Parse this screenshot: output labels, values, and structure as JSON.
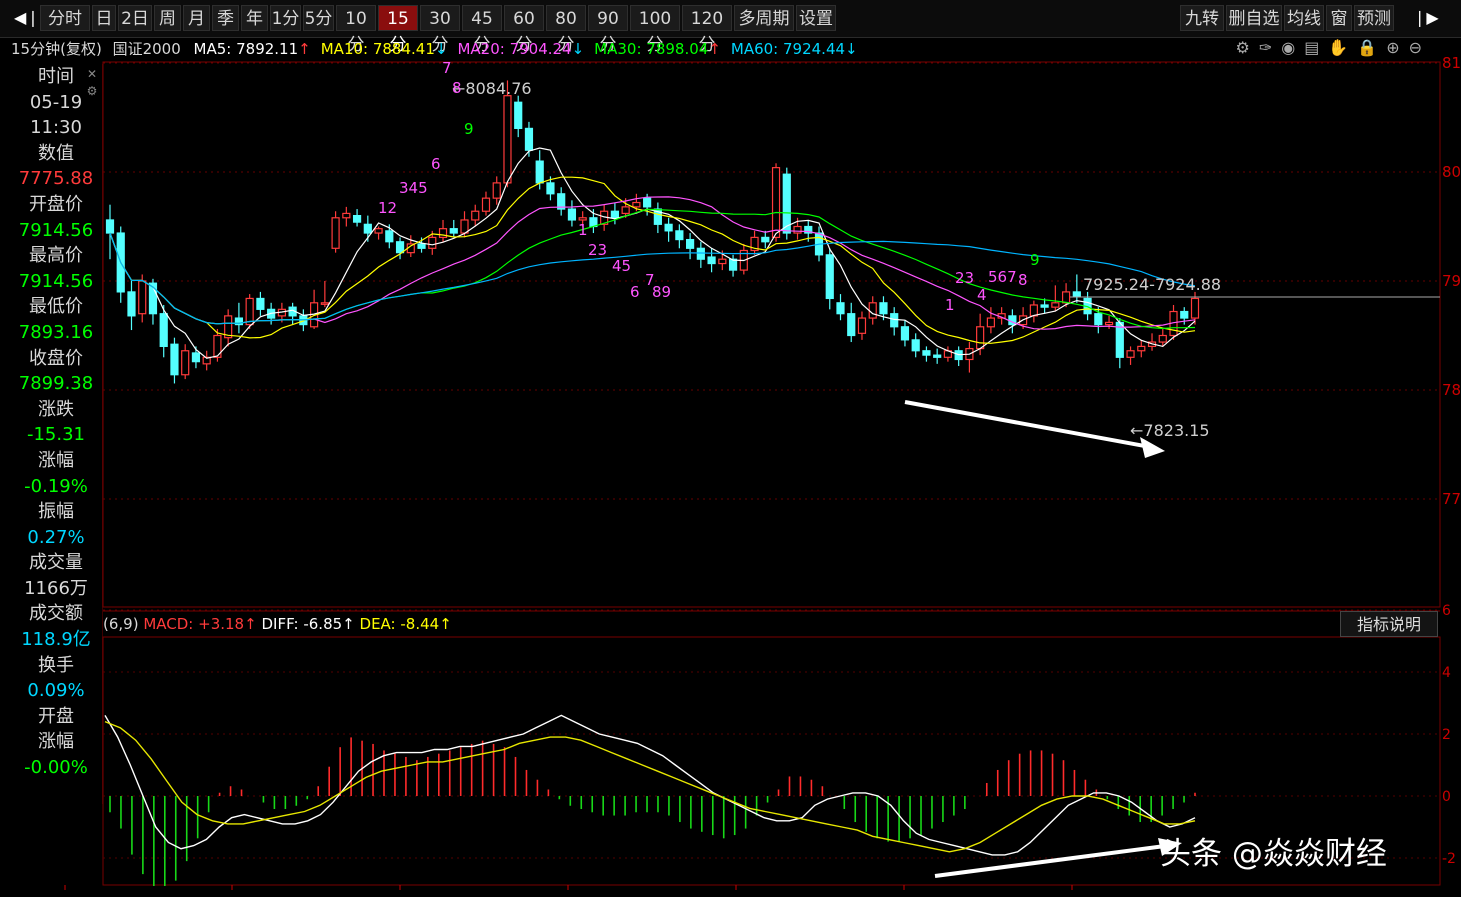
{
  "toolbar": {
    "periods": [
      "分时",
      "日",
      "2日",
      "周",
      "月",
      "季",
      "年",
      "1分",
      "5分",
      "10分",
      "15分",
      "30分",
      "45分",
      "60分",
      "80分",
      "90分",
      "100分",
      "120分",
      "多周期",
      "设置"
    ],
    "active_period": "15分",
    "right_tools": [
      "九转",
      "删自选",
      "均线",
      "窗",
      "预测"
    ]
  },
  "header": {
    "title": "15分钟(复权)",
    "index_name": "国证2000",
    "ma": [
      {
        "label": "MA5: 7892.11",
        "arrow": "↑",
        "color": "#ffffff"
      },
      {
        "label": "MA10: 7884.41",
        "arrow": "↓",
        "color": "#ffff00"
      },
      {
        "label": "MA20: 7904.24",
        "arrow": "↓",
        "color": "#ff55ff"
      },
      {
        "label": "MA30: 7898.04",
        "arrow": "↑",
        "color": "#00ff00"
      },
      {
        "label": "MA60: 7924.44",
        "arrow": "↓",
        "color": "#00d7ff"
      }
    ]
  },
  "info_panel": {
    "time_label": "时间",
    "date": "05-19",
    "time": "11:30",
    "value_label": "数值",
    "value": "7775.88",
    "open_label": "开盘价",
    "open": "7914.56",
    "high_label": "最高价",
    "high": "7914.56",
    "low_label": "最低价",
    "low": "7893.16",
    "close_label": "收盘价",
    "close": "7899.38",
    "change_label": "涨跌",
    "change": "-15.31",
    "pct_label": "涨幅",
    "pct": "-0.19%",
    "amp_label": "振幅",
    "amp": "0.27%",
    "vol_label": "成交量",
    "vol": "1166万",
    "amt_label": "成交额",
    "amt": "118.9亿",
    "turn_label": "换手",
    "turn": "0.09%",
    "open_pct_label1": "开盘",
    "open_pct_label2": "涨幅",
    "open_pct": "-0.00%"
  },
  "macd_header": {
    "params": "(6,9)",
    "macd": "MACD: +3.18",
    "diff": "DIFF: -6.85",
    "dea": "DEA: -8.44"
  },
  "indicator_button": "指标说明",
  "watermark": "头条 @焱焱财经",
  "chart_data": {
    "type": "candlestick",
    "price_axis_partial": [
      "81",
      "80",
      "79",
      "78",
      "77"
    ],
    "macd_axis_partial": [
      "6",
      "4",
      "2",
      "0",
      "-2"
    ],
    "annotations": {
      "high_marker": "8084.76",
      "low_marker": "7823.15",
      "price_line_label": "7925.24-7924.88"
    },
    "td_counts": [
      {
        "text": "12",
        "color": "#ff55ff"
      },
      {
        "text": "345",
        "color": "#ff55ff"
      },
      {
        "text": "6",
        "color": "#ff55ff"
      },
      {
        "text": "7",
        "color": "#ff55ff"
      },
      {
        "text": "8",
        "color": "#ff55ff"
      },
      {
        "text": "9",
        "color": "#00ff00"
      },
      {
        "text": "1",
        "color": "#ff55ff"
      },
      {
        "text": "23",
        "color": "#ff55ff"
      },
      {
        "text": "45",
        "color": "#ff55ff"
      },
      {
        "text": "6",
        "color": "#ff55ff"
      },
      {
        "text": "7",
        "color": "#ff55ff"
      },
      {
        "text": "89",
        "color": "#ff55ff"
      },
      {
        "text": "1",
        "color": "#ff55ff"
      },
      {
        "text": "23",
        "color": "#ff55ff"
      },
      {
        "text": "4",
        "color": "#ff55ff"
      },
      {
        "text": "567",
        "color": "#ff55ff"
      },
      {
        "text": "8",
        "color": "#ff55ff"
      },
      {
        "text": "9",
        "color": "#00ff00"
      }
    ],
    "candles": [
      [
        7956,
        7944,
        7970,
        7920
      ],
      [
        7944,
        7890,
        7950,
        7880
      ],
      [
        7890,
        7868,
        7900,
        7855
      ],
      [
        7870,
        7900,
        7906,
        7862
      ],
      [
        7898,
        7870,
        7902,
        7860
      ],
      [
        7870,
        7840,
        7878,
        7830
      ],
      [
        7842,
        7814,
        7848,
        7806
      ],
      [
        7814,
        7836,
        7842,
        7810
      ],
      [
        7834,
        7826,
        7840,
        7820
      ],
      [
        7824,
        7830,
        7836,
        7818
      ],
      [
        7830,
        7850,
        7856,
        7826
      ],
      [
        7848,
        7868,
        7874,
        7840
      ],
      [
        7866,
        7860,
        7880,
        7852
      ],
      [
        7860,
        7884,
        7888,
        7856
      ],
      [
        7884,
        7874,
        7890,
        7868
      ],
      [
        7874,
        7866,
        7880,
        7860
      ],
      [
        7868,
        7874,
        7880,
        7862
      ],
      [
        7876,
        7868,
        7880,
        7860
      ],
      [
        7868,
        7860,
        7874,
        7854
      ],
      [
        7858,
        7880,
        7892,
        7856
      ],
      [
        7880,
        7880,
        7900,
        7876
      ],
      [
        7930,
        7958,
        7964,
        7926
      ],
      [
        7958,
        7962,
        7968,
        7950
      ],
      [
        7960,
        7954,
        7966,
        7950
      ],
      [
        7952,
        7944,
        7960,
        7936
      ],
      [
        7944,
        7948,
        7950,
        7938
      ],
      [
        7946,
        7936,
        7952,
        7930
      ],
      [
        7936,
        7926,
        7940,
        7920
      ],
      [
        7926,
        7934,
        7942,
        7922
      ],
      [
        7934,
        7930,
        7940,
        7926
      ],
      [
        7930,
        7940,
        7946,
        7924
      ],
      [
        7940,
        7948,
        7956,
        7936
      ],
      [
        7948,
        7944,
        7956,
        7940
      ],
      [
        7944,
        7956,
        7964,
        7940
      ],
      [
        7956,
        7964,
        7970,
        7950
      ],
      [
        7964,
        7976,
        7982,
        7960
      ],
      [
        7976,
        7990,
        7996,
        7970
      ],
      [
        7990,
        8070,
        8084,
        7986
      ],
      [
        8064,
        8040,
        8070,
        8032
      ],
      [
        8040,
        8020,
        8046,
        8014
      ],
      [
        8010,
        7990,
        8020,
        7984
      ],
      [
        7990,
        7980,
        7996,
        7974
      ],
      [
        7980,
        7966,
        7986,
        7960
      ],
      [
        7966,
        7956,
        7974,
        7950
      ],
      [
        7956,
        7958,
        7964,
        7950
      ],
      [
        7958,
        7950,
        7966,
        7944
      ],
      [
        7952,
        7964,
        7970,
        7946
      ],
      [
        7964,
        7958,
        7972,
        7952
      ],
      [
        7962,
        7968,
        7976,
        7958
      ],
      [
        7968,
        7972,
        7980,
        7964
      ],
      [
        7976,
        7968,
        7980,
        7960
      ],
      [
        7966,
        7952,
        7972,
        7944
      ],
      [
        7952,
        7946,
        7958,
        7936
      ],
      [
        7946,
        7938,
        7952,
        7930
      ],
      [
        7938,
        7930,
        7944,
        7920
      ],
      [
        7930,
        7920,
        7936,
        7912
      ],
      [
        7922,
        7916,
        7930,
        7908
      ],
      [
        7916,
        7920,
        7928,
        7910
      ],
      [
        7920,
        7910,
        7924,
        7904
      ],
      [
        7910,
        7928,
        7934,
        7906
      ],
      [
        7928,
        7940,
        7946,
        7924
      ],
      [
        7940,
        7936,
        7946,
        7930
      ],
      [
        7940,
        8004,
        8008,
        7936
      ],
      [
        7998,
        7944,
        8004,
        7938
      ],
      [
        7944,
        7950,
        7958,
        7938
      ],
      [
        7950,
        7944,
        7956,
        7936
      ],
      [
        7944,
        7924,
        7950,
        7918
      ],
      [
        7924,
        7884,
        7930,
        7874
      ],
      [
        7880,
        7870,
        7888,
        7864
      ],
      [
        7870,
        7850,
        7880,
        7844
      ],
      [
        7852,
        7866,
        7872,
        7846
      ],
      [
        7866,
        7880,
        7886,
        7860
      ],
      [
        7880,
        7870,
        7886,
        7864
      ],
      [
        7870,
        7858,
        7876,
        7850
      ],
      [
        7858,
        7846,
        7864,
        7840
      ],
      [
        7846,
        7836,
        7852,
        7830
      ],
      [
        7836,
        7832,
        7840,
        7826
      ],
      [
        7832,
        7830,
        7838,
        7824
      ],
      [
        7830,
        7836,
        7840,
        7826
      ],
      [
        7836,
        7828,
        7840,
        7822
      ],
      [
        7828,
        7838,
        7844,
        7816
      ],
      [
        7838,
        7858,
        7870,
        7832
      ],
      [
        7858,
        7866,
        7876,
        7852
      ],
      [
        7866,
        7870,
        7876,
        7860
      ],
      [
        7868,
        7860,
        7874,
        7852
      ],
      [
        7860,
        7868,
        7876,
        7856
      ],
      [
        7868,
        7878,
        7882,
        7862
      ],
      [
        7878,
        7876,
        7884,
        7870
      ],
      [
        7876,
        7880,
        7896,
        7872
      ],
      [
        7880,
        7890,
        7898,
        7876
      ],
      [
        7890,
        7886,
        7906,
        7880
      ],
      [
        7884,
        7870,
        7890,
        7864
      ],
      [
        7870,
        7860,
        7876,
        7852
      ],
      [
        7860,
        7862,
        7868,
        7856
      ],
      [
        7862,
        7830,
        7866,
        7820
      ],
      [
        7830,
        7836,
        7840,
        7823
      ],
      [
        7836,
        7840,
        7846,
        7830
      ],
      [
        7840,
        7844,
        7852,
        7836
      ],
      [
        7844,
        7850,
        7856,
        7840
      ],
      [
        7850,
        7872,
        7878,
        7846
      ],
      [
        7872,
        7866,
        7876,
        7860
      ],
      [
        7866,
        7884,
        7890,
        7860
      ]
    ],
    "macd_hist": [
      -0.5,
      -1.0,
      -1.8,
      -2.4,
      -2.8,
      -2.9,
      -2.6,
      -2.0,
      -1.3,
      -0.5,
      0.1,
      0.3,
      0.2,
      0.0,
      -0.2,
      -0.4,
      -0.4,
      -0.3,
      -0.1,
      0.3,
      0.9,
      1.5,
      1.8,
      1.7,
      1.6,
      1.4,
      1.3,
      1.2,
      1.1,
      1.2,
      1.3,
      1.4,
      1.5,
      1.6,
      1.7,
      1.6,
      1.5,
      1.2,
      0.8,
      0.5,
      0.2,
      -0.1,
      -0.3,
      -0.4,
      -0.5,
      -0.6,
      -0.6,
      -0.6,
      -0.5,
      -0.5,
      -0.5,
      -0.6,
      -0.8,
      -1.0,
      -1.1,
      -1.2,
      -1.3,
      -1.2,
      -1.0,
      -0.6,
      -0.2,
      0.2,
      0.6,
      0.6,
      0.5,
      0.3,
      0.0,
      -0.4,
      -0.8,
      -1.1,
      -1.3,
      -1.4,
      -1.4,
      -1.3,
      -1.2,
      -1.0,
      -0.8,
      -0.6,
      -0.4,
      0.0,
      0.4,
      0.8,
      1.1,
      1.3,
      1.4,
      1.4,
      1.3,
      1.1,
      0.8,
      0.5,
      0.2,
      -0.1,
      -0.4,
      -0.6,
      -0.8,
      -0.8,
      -0.6,
      -0.4,
      -0.2,
      0.1
    ],
    "macd_diff": [
      2.6,
      1.9,
      1.0,
      0.0,
      -1.0,
      -1.5,
      -1.7,
      -1.6,
      -1.4,
      -1.0,
      -0.7,
      -0.6,
      -0.7,
      -0.8,
      -0.9,
      -0.9,
      -0.8,
      -0.6,
      -0.2,
      0.3,
      0.8,
      1.1,
      1.3,
      1.4,
      1.4,
      1.4,
      1.5,
      1.5,
      1.6,
      1.6,
      1.7,
      1.8,
      1.9,
      2.0,
      2.2,
      2.4,
      2.6,
      2.4,
      2.2,
      2.0,
      1.9,
      1.8,
      1.7,
      1.5,
      1.3,
      1.0,
      0.7,
      0.4,
      0.1,
      -0.1,
      -0.3,
      -0.5,
      -0.7,
      -0.8,
      -0.8,
      -0.7,
      -0.3,
      -0.1,
      0.0,
      0.1,
      0.1,
      0.0,
      -0.3,
      -0.8,
      -1.2,
      -1.4,
      -1.5,
      -1.6,
      -1.7,
      -1.8,
      -1.9,
      -1.9,
      -1.8,
      -1.5,
      -1.1,
      -0.7,
      -0.3,
      -0.1,
      0.1,
      0.1,
      0.0,
      -0.2,
      -0.5,
      -0.8,
      -1.0,
      -0.9,
      -0.7
    ],
    "macd_dea": [
      2.4,
      2.2,
      1.8,
      1.2,
      0.5,
      -0.2,
      -0.6,
      -0.8,
      -0.9,
      -0.9,
      -0.8,
      -0.7,
      -0.6,
      -0.5,
      -0.3,
      0.0,
      0.3,
      0.6,
      0.8,
      0.9,
      1.0,
      1.1,
      1.1,
      1.2,
      1.3,
      1.4,
      1.5,
      1.7,
      1.8,
      1.9,
      1.9,
      1.8,
      1.6,
      1.4,
      1.2,
      1.0,
      0.8,
      0.6,
      0.4,
      0.2,
      0.0,
      -0.2,
      -0.4,
      -0.5,
      -0.6,
      -0.7,
      -0.8,
      -0.9,
      -1.0,
      -1.1,
      -1.3,
      -1.4,
      -1.5,
      -1.6,
      -1.7,
      -1.8,
      -1.7,
      -1.5,
      -1.2,
      -0.9,
      -0.6,
      -0.3,
      -0.1,
      0.0,
      0.0,
      -0.1,
      -0.3,
      -0.5,
      -0.7,
      -0.9,
      -0.9,
      -0.8
    ]
  }
}
